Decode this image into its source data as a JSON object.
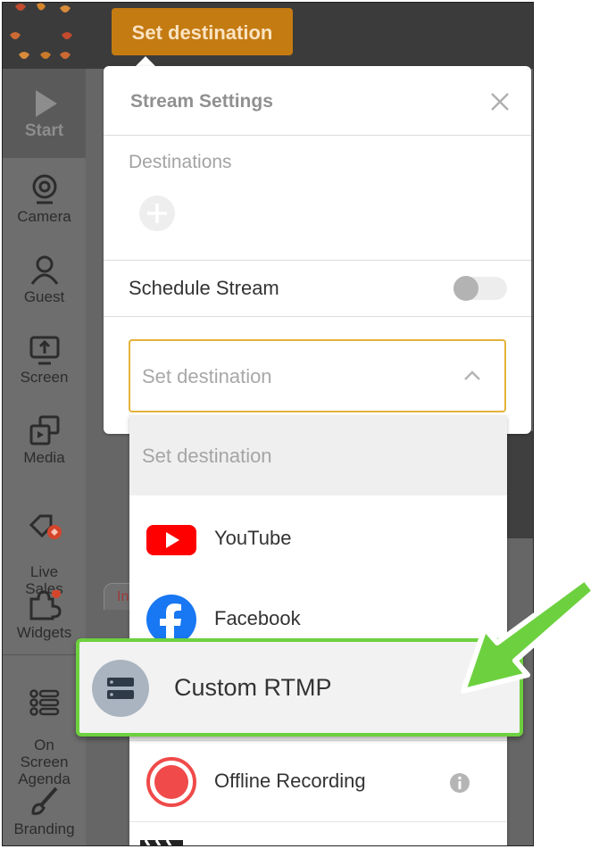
{
  "topbar": {
    "set_destination_label": "Set destination"
  },
  "sidebar": {
    "items": [
      {
        "label": "Start"
      },
      {
        "label": "Camera"
      },
      {
        "label": "Guest"
      },
      {
        "label": "Screen"
      },
      {
        "label": "Media"
      },
      {
        "label": "Live\nSales"
      },
      {
        "label": "Widgets"
      },
      {
        "label": "On\nScreen\nAgenda"
      },
      {
        "label": "Branding"
      }
    ]
  },
  "background_tab_label": "In",
  "panel": {
    "title": "Stream Settings",
    "destinations_label": "Destinations",
    "schedule_label": "Schedule Stream",
    "schedule_enabled": false,
    "select_value": "Set destination"
  },
  "dropdown": {
    "header": "Set destination",
    "options": [
      {
        "label": "YouTube",
        "icon": "youtube-icon"
      },
      {
        "label": "Facebook",
        "icon": "facebook-icon"
      },
      {
        "label": "Custom RTMP",
        "icon": "server-icon"
      },
      {
        "label": "Offline Recording",
        "icon": "record-icon"
      }
    ]
  },
  "colors": {
    "accent": "#c47b12",
    "highlight": "#6dd13f",
    "youtube": "#ff0000",
    "facebook": "#1877f2",
    "record": "#f04a4a"
  }
}
